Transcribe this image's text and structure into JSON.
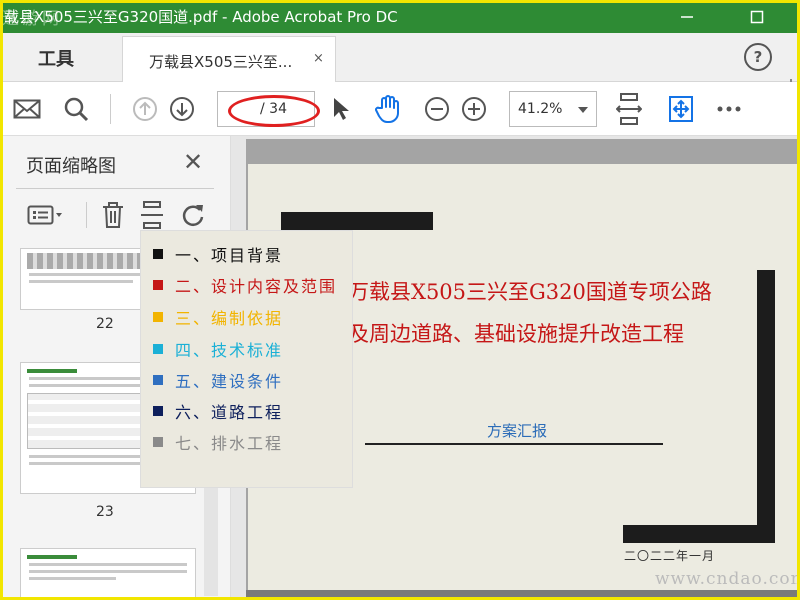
{
  "window": {
    "title": "载县X505三兴至G320国道.pdf - Adobe Acrobat Pro DC",
    "logo_text": "逸游网"
  },
  "tabs": {
    "tools_label": "工具",
    "doc_label": "万载县X505三兴至...",
    "close_glyph": "×"
  },
  "toolbar": {
    "page_current": "",
    "page_count": "/ 34",
    "zoom": "41.2%"
  },
  "panel": {
    "title": "页面缩略图",
    "thumbnails": [
      {
        "page": "22"
      },
      {
        "page": "23"
      }
    ]
  },
  "toc": [
    {
      "label": "一、项目背景",
      "color": "#111111"
    },
    {
      "label": "二、设计内容及范围",
      "color": "#c51717"
    },
    {
      "label": "三、编制依据",
      "color": "#f2b400"
    },
    {
      "label": "四、技术标准",
      "color": "#1bb0d6"
    },
    {
      "label": "五、建设条件",
      "color": "#2f6fc0"
    },
    {
      "label": "六、道路工程",
      "color": "#0d1f5c"
    },
    {
      "label": "七、排水工程",
      "color": "#8a8a8a"
    }
  ],
  "document": {
    "title_line1": "万载县X505三兴至G320国道专项公路",
    "title_line2": "及周边道路、基础设施提升改造工程",
    "subtitle": "方案汇报",
    "date": "二〇二二年一月"
  },
  "watermark": "www.cndao.com",
  "colors": {
    "titlebar": "#2e8b34",
    "accent_blue": "#1473e6",
    "callout_red": "#e02020"
  }
}
